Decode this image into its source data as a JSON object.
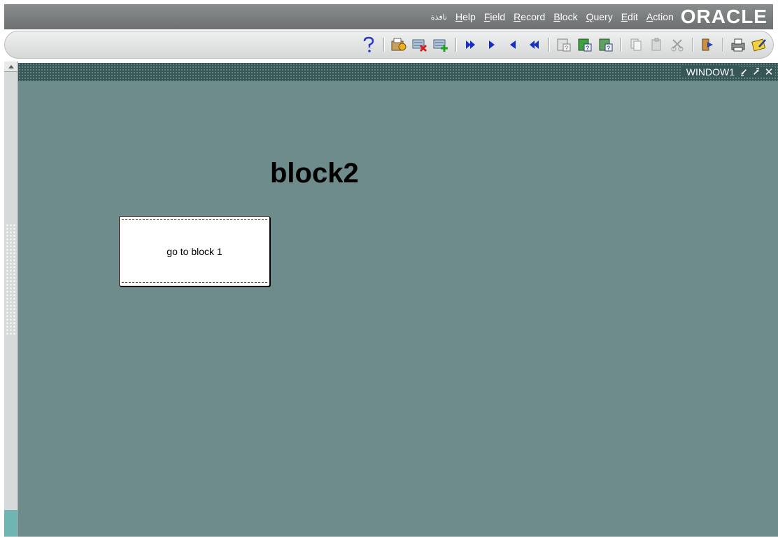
{
  "menubar": {
    "items": [
      {
        "label": "نافذة",
        "small": true
      },
      {
        "mnemonic": "H",
        "rest": "elp"
      },
      {
        "mnemonic": "F",
        "rest": "ield"
      },
      {
        "mnemonic": "R",
        "rest": "ecord"
      },
      {
        "mnemonic": "B",
        "rest": "lock"
      },
      {
        "mnemonic": "Q",
        "rest": "uery"
      },
      {
        "mnemonic": "E",
        "rest": "dit"
      },
      {
        "mnemonic": "A",
        "rest": "ction"
      }
    ],
    "logo": "ORACLE"
  },
  "toolbar": {
    "buttons": [
      "help-icon",
      "sep",
      "save-icon",
      "clear-record-icon",
      "insert-record-icon",
      "sep",
      "last-record-icon",
      "next-record-icon",
      "previous-record-icon",
      "first-record-icon",
      "sep",
      "enter-query-icon",
      "execute-query-icon",
      "cancel-query-icon",
      "sep",
      "copy-icon",
      "paste-icon",
      "cut-icon",
      "sep",
      "exit-icon",
      "sep",
      "print-icon",
      "edit-icon"
    ]
  },
  "window": {
    "title": "WINDOW1",
    "controls": [
      "minimize-icon",
      "maximize-icon",
      "close-icon"
    ]
  },
  "canvas": {
    "heading": "block2",
    "button_label": "go to block 1"
  },
  "colors": {
    "canvas": "#6e8c8c",
    "titlebar": "#375757",
    "menubar": "#7b7e7e"
  }
}
